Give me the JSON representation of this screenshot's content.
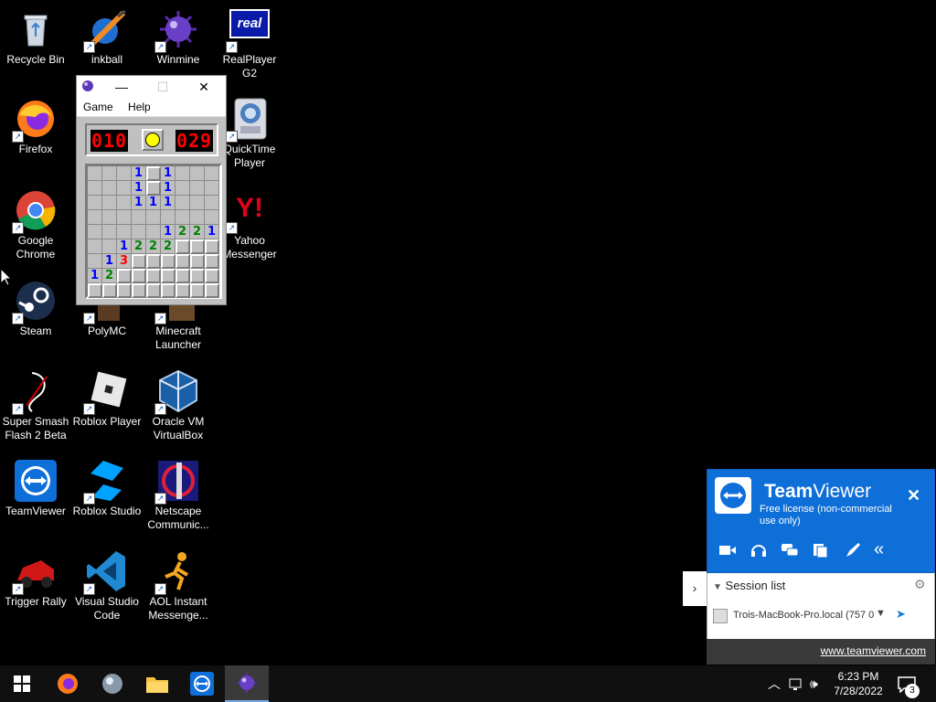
{
  "desktop_icons": [
    {
      "id": "recycle-bin",
      "label": "Recycle Bin"
    },
    {
      "id": "inkball",
      "label": "inkball"
    },
    {
      "id": "winmine",
      "label": "Winmine"
    },
    {
      "id": "realplayer",
      "label": "RealPlayer G2"
    },
    {
      "id": "firefox",
      "label": "Firefox"
    },
    {
      "id": "quicktime",
      "label": "QuickTime Player"
    },
    {
      "id": "chrome",
      "label": "Google Chrome"
    },
    {
      "id": "yahoo",
      "label": "Yahoo Messenger"
    },
    {
      "id": "steam",
      "label": "Steam"
    },
    {
      "id": "polymc",
      "label": "PolyMC"
    },
    {
      "id": "minecraft",
      "label": "Minecraft Launcher"
    },
    {
      "id": "ssf2",
      "label": "Super Smash Flash 2 Beta"
    },
    {
      "id": "roblox-player",
      "label": "Roblox Player"
    },
    {
      "id": "virtualbox",
      "label": "Oracle VM VirtualBox"
    },
    {
      "id": "teamviewer",
      "label": "TeamViewer"
    },
    {
      "id": "roblox-studio",
      "label": "Roblox Studio"
    },
    {
      "id": "netscape",
      "label": "Netscape Communic..."
    },
    {
      "id": "trigger-rally",
      "label": "Trigger Rally"
    },
    {
      "id": "vscode",
      "label": "Visual Studio Code"
    },
    {
      "id": "aim",
      "label": "AOL Instant Messenge..."
    }
  ],
  "realplayer_logo_text": "real",
  "yahoo_logo_text": "Y!",
  "minesweeper": {
    "menu": {
      "game": "Game",
      "help": "Help"
    },
    "mines_left": "010",
    "timer": "029",
    "grid": [
      [
        "",
        "",
        "",
        "1",
        "#",
        "1",
        "",
        "",
        ""
      ],
      [
        "",
        "",
        "",
        "1",
        "#",
        "1",
        "",
        "",
        ""
      ],
      [
        "",
        "",
        "",
        "1",
        "1",
        "1",
        "",
        "",
        ""
      ],
      [
        "",
        "",
        "",
        "",
        "",
        "",
        "",
        "",
        ""
      ],
      [
        "",
        "",
        "",
        "",
        "",
        "1",
        "2",
        "2",
        "1"
      ],
      [
        "",
        "",
        "1",
        "2",
        "2",
        "2",
        "#",
        "#",
        "#"
      ],
      [
        "",
        "1",
        "3",
        "#",
        "#",
        "#",
        "#",
        "#",
        "#"
      ],
      [
        "1",
        "2",
        "#",
        "#",
        "#",
        "#",
        "#",
        "#",
        "#"
      ],
      [
        "#",
        "#",
        "#",
        "#",
        "#",
        "#",
        "#",
        "#",
        "#"
      ]
    ]
  },
  "teamviewer": {
    "brand_team": "Team",
    "brand_viewer": "Viewer",
    "license": "Free license (non-commercial use only)",
    "close": "✕",
    "session_list": "Session list",
    "session_item": "Trois-MacBook-Pro.local (757 0",
    "link": "www.teamviewer.com",
    "tab_arrow": "›"
  },
  "taskbar": {
    "clock_time": "6:23 PM",
    "clock_date": "7/28/2022",
    "notification_count": "3"
  }
}
